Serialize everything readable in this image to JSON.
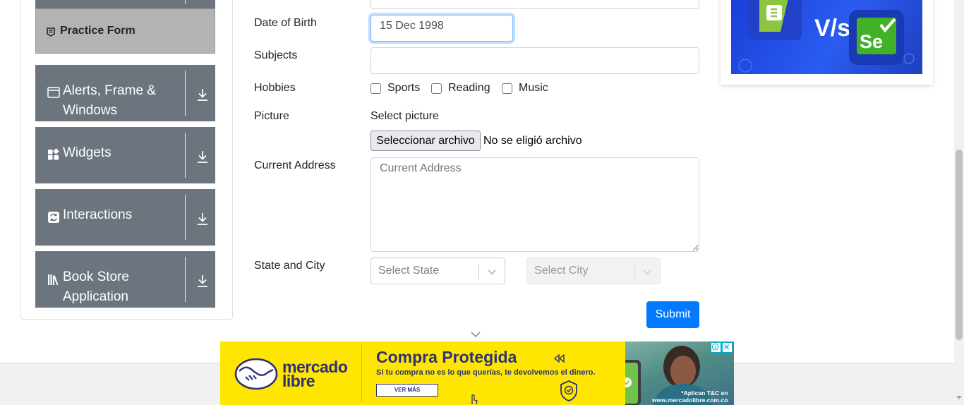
{
  "sidebar": {
    "active_item": "Practice Form",
    "groups": [
      {
        "label": "Alerts, Frame &",
        "label2": "Windows",
        "icon": "window-icon"
      },
      {
        "label": "Widgets",
        "icon": "widgets-icon"
      },
      {
        "label": "Interactions",
        "icon": "interactions-icon"
      },
      {
        "label": "Book Store",
        "label2": "Application",
        "icon": "books-icon"
      }
    ]
  },
  "form": {
    "dob_label": "Date of Birth",
    "dob_value": "15 Dec 1998",
    "subjects_label": "Subjects",
    "hobbies_label": "Hobbies",
    "hobbies": [
      "Sports",
      "Reading",
      "Music"
    ],
    "picture_label": "Picture",
    "select_picture_label": "Select picture",
    "file_button": "Seleccionar archivo",
    "file_status": "No se eligió archivo",
    "address_label": "Current Address",
    "address_placeholder": "Current Address",
    "state_city_label": "State and City",
    "state_placeholder": "Select State",
    "city_placeholder": "Select City",
    "submit": "Submit"
  },
  "banner": {
    "brand": "mercado",
    "brand2": "libre",
    "headline": "Compra Protegida",
    "subtext": "Si tu compra no es lo que querías, te devolvemos el dinero.",
    "cta": "VER MÁS",
    "legal1": "*Aplican T&C en",
    "legal2": "www.mercadolibre.com.co"
  },
  "colors": {
    "primary": "#007bff",
    "sidebar_group": "#6c757d",
    "active_item": "#b3b3b3",
    "banner_yellow": "#ffe600",
    "banner_navy": "#2d3277"
  }
}
